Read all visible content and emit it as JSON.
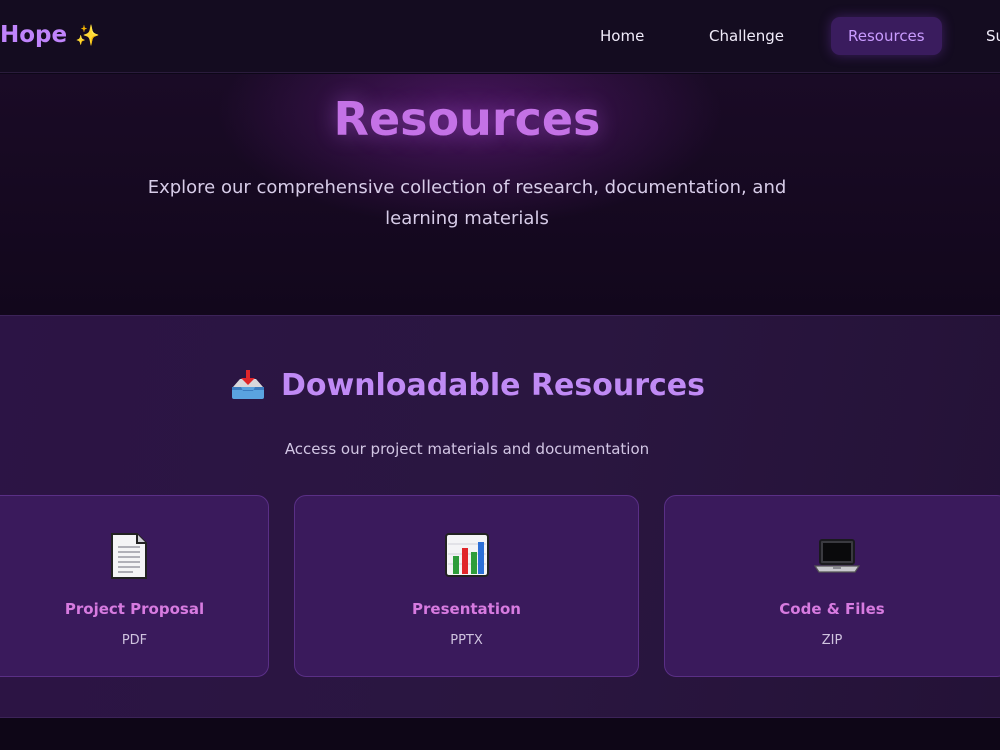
{
  "nav": {
    "brand": "Hope",
    "brand_sparkle": "✨",
    "links": [
      {
        "label": "Home"
      },
      {
        "label": "Challenge"
      },
      {
        "label": "Resources",
        "active": true
      },
      {
        "label": "Su"
      }
    ]
  },
  "hero": {
    "title": "Resources",
    "subtitle": "Explore our comprehensive collection of research, documentation, and learning materials"
  },
  "downloads": {
    "icon": "inbox-tray-icon",
    "title": "Downloadable Resources",
    "subtitle": "Access our project materials and documentation",
    "cards": [
      {
        "icon": "document-icon",
        "title": "Project Proposal",
        "type": "PDF"
      },
      {
        "icon": "bar-chart-icon",
        "title": "Presentation",
        "type": "PPTX"
      },
      {
        "icon": "laptop-icon",
        "title": "Code & Files",
        "type": "ZIP"
      }
    ]
  },
  "colors": {
    "accent": "#c084fc",
    "card_title": "#d77be0",
    "card_bg": "#3a1a5c",
    "page_bg": "#0d0718"
  }
}
